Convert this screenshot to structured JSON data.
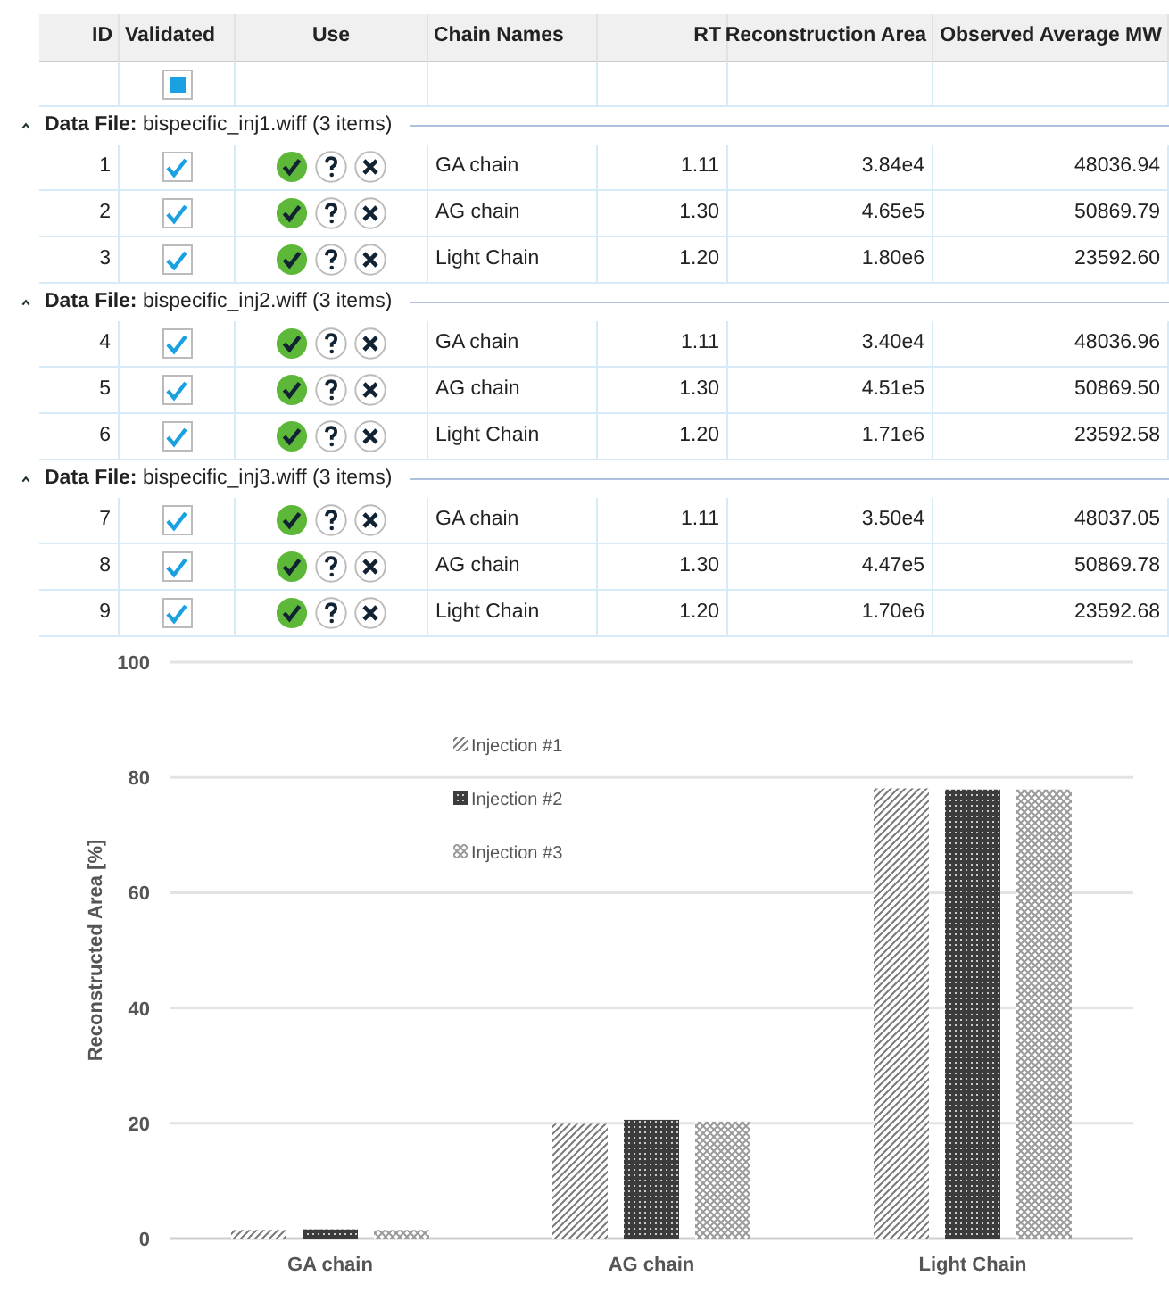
{
  "table": {
    "columns": [
      "ID",
      "Validated",
      "Use",
      "Chain Names",
      "RT",
      "Reconstruction Area",
      "Observed Average MW"
    ],
    "filter": {
      "validated_indeterminate": true
    },
    "groups": [
      {
        "label": "**Data File:** bispecific_inj1.wiff (3 items)",
        "expanded": true,
        "rows": [
          {
            "id": "1",
            "validated": true,
            "chain": "GA chain",
            "rt": "1.11",
            "area": "3.84e4",
            "mw": "48036.94"
          },
          {
            "id": "2",
            "validated": true,
            "chain": "AG chain",
            "rt": "1.30",
            "area": "4.65e5",
            "mw": "50869.79"
          },
          {
            "id": "3",
            "validated": true,
            "chain": "Light Chain",
            "rt": "1.20",
            "area": "1.80e6",
            "mw": "23592.60"
          }
        ]
      },
      {
        "label": "**Data File:** bispecific_inj2.wiff (3 items)",
        "expanded": true,
        "rows": [
          {
            "id": "4",
            "validated": true,
            "chain": "GA chain",
            "rt": "1.11",
            "area": "3.40e4",
            "mw": "48036.96"
          },
          {
            "id": "5",
            "validated": true,
            "chain": "AG chain",
            "rt": "1.30",
            "area": "4.51e5",
            "mw": "50869.50"
          },
          {
            "id": "6",
            "validated": true,
            "chain": "Light Chain",
            "rt": "1.20",
            "area": "1.71e6",
            "mw": "23592.58"
          }
        ]
      },
      {
        "label": "**Data File:** bispecific_inj3.wiff (3 items)",
        "expanded": true,
        "rows": [
          {
            "id": "7",
            "validated": true,
            "chain": "GA chain",
            "rt": "1.11",
            "area": "3.50e4",
            "mw": "48037.05"
          },
          {
            "id": "8",
            "validated": true,
            "chain": "AG chain",
            "rt": "1.30",
            "area": "4.47e5",
            "mw": "50869.78"
          },
          {
            "id": "9",
            "validated": true,
            "chain": "Light Chain",
            "rt": "1.20",
            "area": "1.70e6",
            "mw": "23592.68"
          }
        ]
      }
    ]
  },
  "chart": {
    "chart_data": {
      "type": "bar",
      "ylabel": "Reconstructed Area [%]",
      "categories": [
        "GA chain",
        "AG chain",
        "Light Chain"
      ],
      "series": [
        {
          "name": "Injection #1",
          "color": "#7a7a7a",
          "values": [
            1.5,
            19.9,
            78.1
          ]
        },
        {
          "name": "Injection #2",
          "color": "#3c3c3c",
          "values": [
            1.6,
            20.6,
            77.9
          ]
        },
        {
          "name": "Injection #3",
          "color": "#9a9a9a",
          "values": [
            1.5,
            20.3,
            77.9
          ]
        }
      ],
      "ylim": [
        0,
        100
      ],
      "yticks": [
        0,
        20,
        40,
        60,
        80,
        100
      ],
      "grid": true,
      "legend": true
    }
  }
}
